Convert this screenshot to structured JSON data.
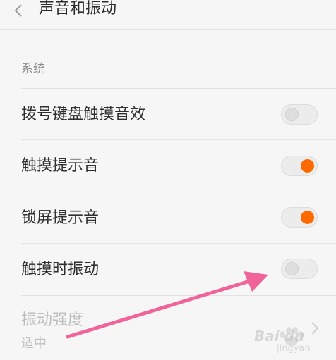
{
  "header": {
    "title": "声音和振动",
    "back_icon": "chevron-left-icon"
  },
  "section": {
    "title": "系统"
  },
  "settings": [
    {
      "label": "拨号键盘触摸音效",
      "enabled": false
    },
    {
      "label": "触摸提示音",
      "enabled": true
    },
    {
      "label": "锁屏提示音",
      "enabled": true
    },
    {
      "label": "触摸时振动",
      "enabled": false
    }
  ],
  "vibration_strength": {
    "label": "振动强度",
    "value": "适中",
    "disabled": true
  },
  "colors": {
    "accent": "#ff6a00",
    "annotation_arrow": "#f0649a"
  },
  "watermark": {
    "text": "Bai du",
    "sub": "jingyan"
  }
}
